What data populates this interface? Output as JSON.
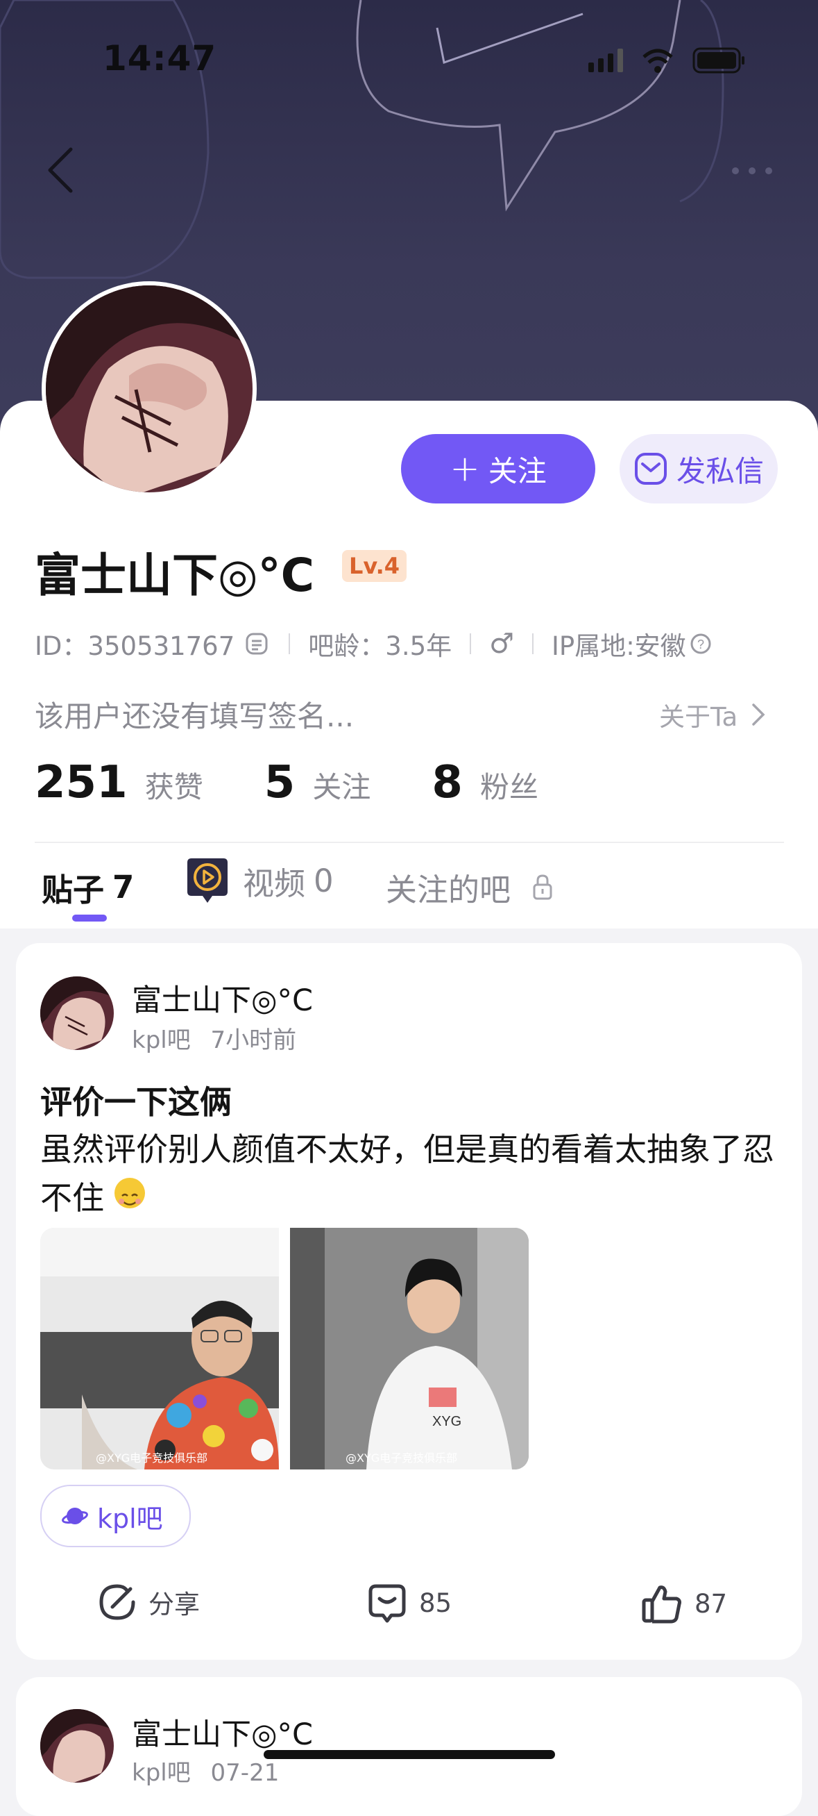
{
  "status_bar": {
    "time": "14:47"
  },
  "profile": {
    "follow_label": "关注",
    "message_label": "发私信",
    "name": "富士山下◎°C",
    "level": "Lv.4",
    "id_text": "ID：350531767",
    "bar_age": "吧龄：3.5年",
    "gender": "♂",
    "ip": "IP属地:安徽",
    "signature": "该用户还没有填写签名...",
    "about_label": "关于Ta",
    "stats": [
      {
        "num": "251",
        "label": "获赞"
      },
      {
        "num": "5",
        "label": "关注"
      },
      {
        "num": "8",
        "label": "粉丝"
      }
    ]
  },
  "tabs": [
    {
      "label": "贴子",
      "count": "7"
    },
    {
      "label": "视频",
      "count": "0"
    },
    {
      "label": "关注的吧"
    }
  ],
  "posts": [
    {
      "author": "富士山下◎°C",
      "forum": "kpl吧",
      "time": "7小时前",
      "title": "评价一下这俩",
      "body": "虽然评价别人颜值不太好，但是真的看着太抽象了忍不住",
      "watermark": "@XYG电子竞技俱乐部",
      "tag": "kpl吧",
      "share_label": "分享",
      "comments": "85",
      "likes": "87"
    },
    {
      "author": "富士山下◎°C",
      "forum": "kpl吧",
      "time": "07-21"
    }
  ],
  "colors": {
    "accent": "#7258f5",
    "header_bg": "#2f2e4b"
  }
}
